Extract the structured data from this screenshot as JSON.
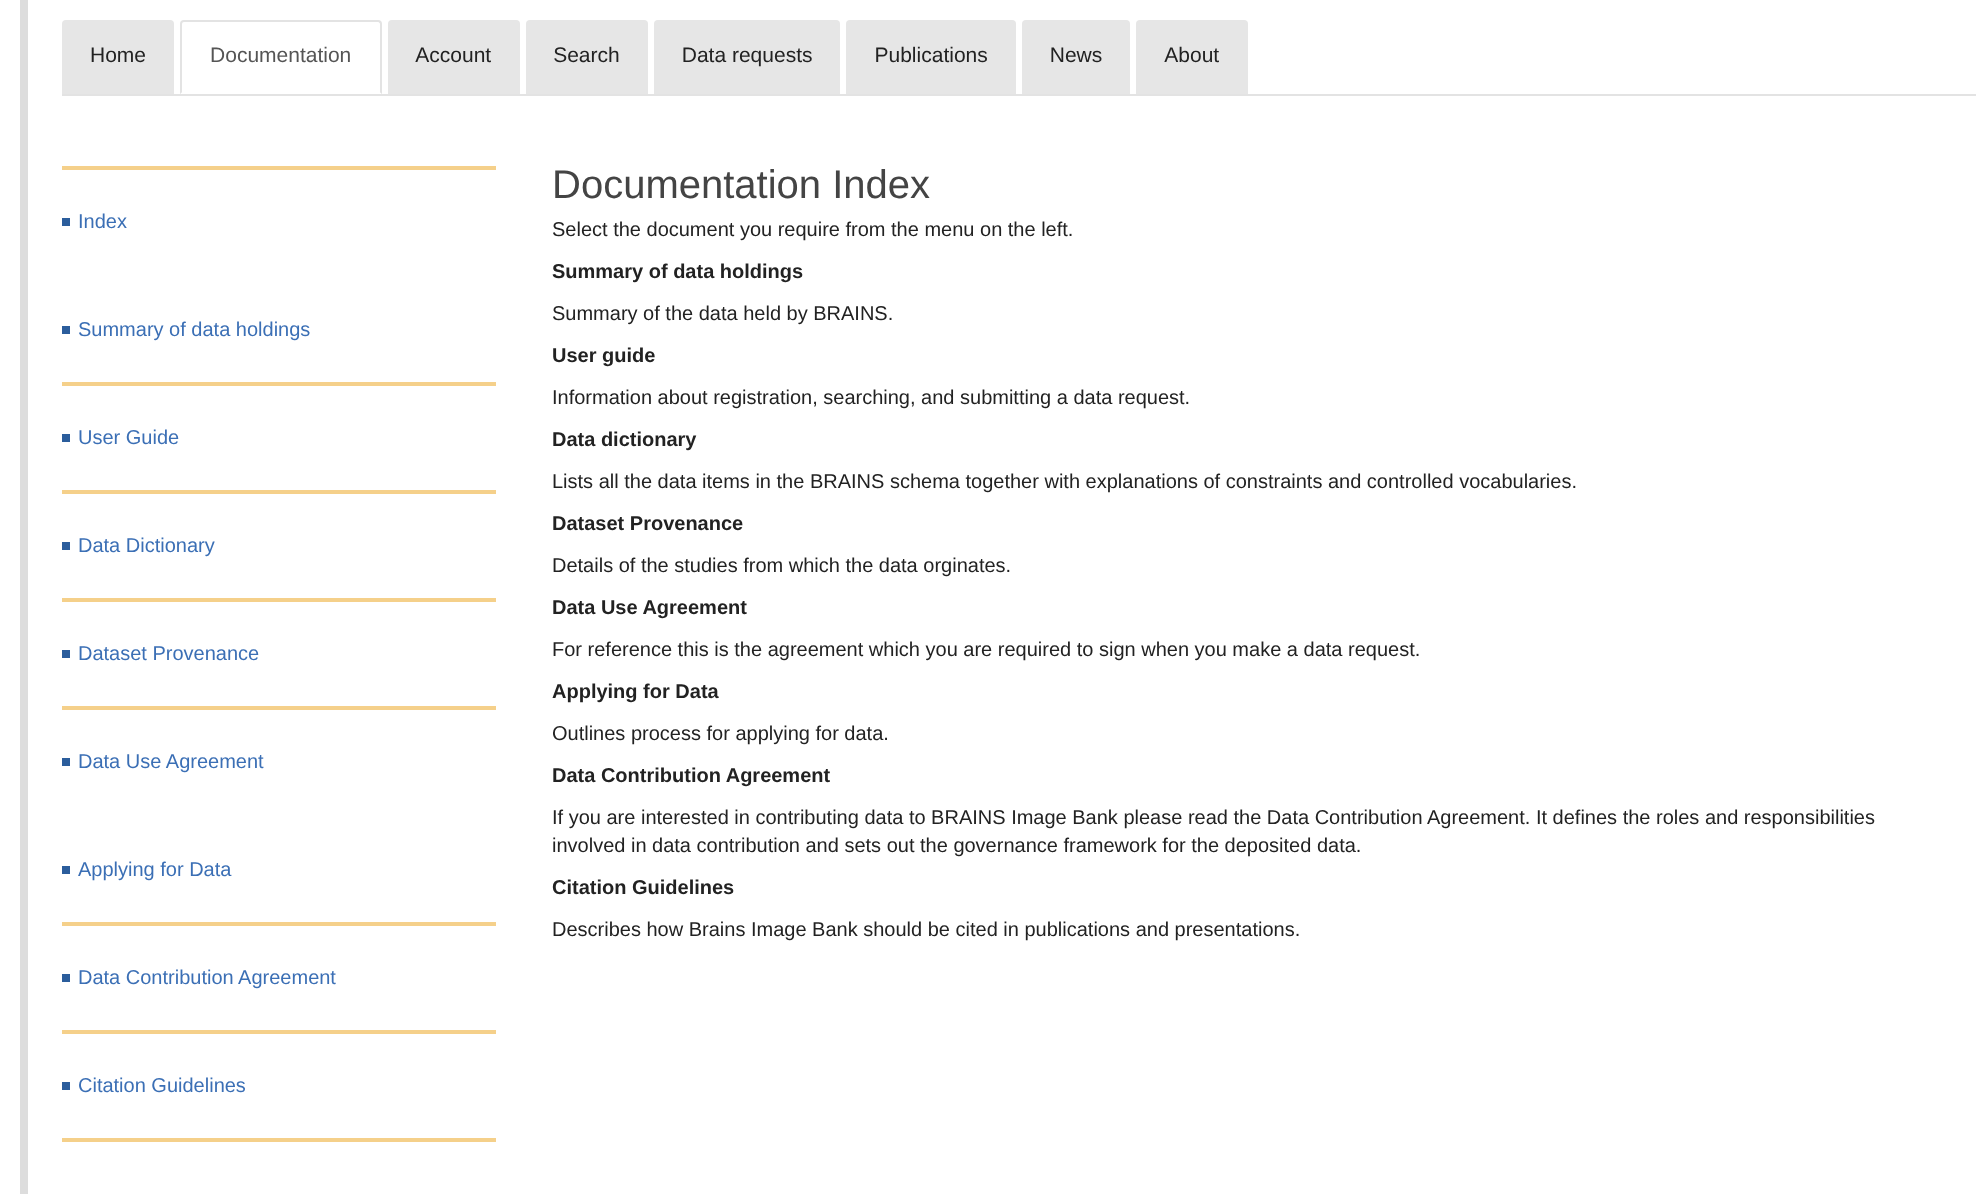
{
  "tabs": [
    {
      "label": "Home",
      "selected": false
    },
    {
      "label": "Documentation",
      "selected": true
    },
    {
      "label": "Account",
      "selected": false
    },
    {
      "label": "Search",
      "selected": false
    },
    {
      "label": "Data requests",
      "selected": false
    },
    {
      "label": "Publications",
      "selected": false
    },
    {
      "label": "News",
      "selected": false
    },
    {
      "label": "About",
      "selected": false
    }
  ],
  "sidebar": {
    "items": [
      {
        "label": "Index",
        "rule_below": false
      },
      {
        "label": "Summary of data holdings",
        "rule_below": true
      },
      {
        "label": "User Guide",
        "rule_below": true
      },
      {
        "label": "Data Dictionary",
        "rule_below": true
      },
      {
        "label": "Dataset Provenance",
        "rule_below": true
      },
      {
        "label": "Data Use Agreement",
        "rule_below": false
      },
      {
        "label": "Applying for Data",
        "rule_below": true
      },
      {
        "label": "Data Contribution Agreement",
        "rule_below": true
      },
      {
        "label": "Citation Guidelines",
        "rule_below": true
      }
    ]
  },
  "content": {
    "title": "Documentation Index",
    "intro": "Select the document you require from the menu on the left.",
    "sections": [
      {
        "heading": "Summary of data holdings",
        "text": "Summary of the data held by BRAINS."
      },
      {
        "heading": "User guide",
        "text": "Information about registration, searching, and submitting a data request."
      },
      {
        "heading": "Data dictionary",
        "text": "Lists all the data items in the BRAINS schema together with explanations of constraints and controlled vocabularies."
      },
      {
        "heading": "Dataset Provenance",
        "text": "Details of the studies from which the data orginates."
      },
      {
        "heading": "Data Use Agreement",
        "text": "For reference this is the agreement which you are required to sign when you make a data request."
      },
      {
        "heading": "Applying for Data",
        "text": "Outlines process for applying for data."
      },
      {
        "heading": "Data Contribution Agreement",
        "text": "If you are interested in contributing data to BRAINS Image Bank please read the Data Contribution Agreement. It defines the roles and responsibilities involved in data contribution and sets out the governance framework for the deposited data."
      },
      {
        "heading": "Citation Guidelines",
        "text": "Describes how Brains Image Bank should be cited in publications and presentations."
      }
    ]
  }
}
